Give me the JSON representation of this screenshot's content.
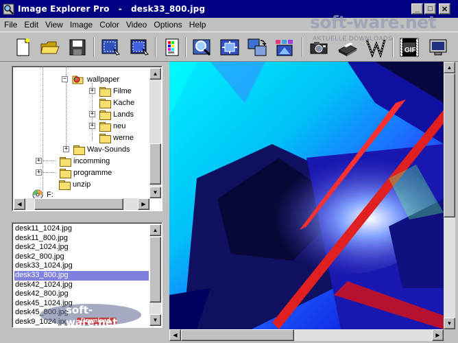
{
  "window": {
    "title": "Image Explorer Pro   -   desk33_800.jpg",
    "buttons": {
      "minimize": "_",
      "maximize": "□",
      "close": "✕"
    }
  },
  "menu": [
    "File",
    "Edit",
    "View",
    "Image",
    "Color",
    "Video",
    "Options",
    "Help"
  ],
  "toolbar": {
    "icons": [
      "new-file-icon",
      "open-folder-icon",
      "save-disk-icon",
      "select-rect-icon",
      "select-active-icon",
      "palette-icon",
      "zoom-icon",
      "fit-window-icon",
      "rotate-icon",
      "thumbnails-icon",
      "camera-icon",
      "scanner-icon",
      "filmstrip-icon",
      "gif-icon",
      "monitor-icon"
    ],
    "gif_label": "GIF"
  },
  "watermark": {
    "top_text": "soft-ware.net",
    "top_sub": "AKTUELLE DOWNLOADS",
    "bottom_text": "soft-ware.net",
    "bottom_sub": "Download"
  },
  "tree": {
    "items": [
      {
        "label": "wallpaper",
        "level": 3,
        "expander": "−",
        "icon": "globe-folder"
      },
      {
        "label": "Filme",
        "level": 4,
        "expander": "+"
      },
      {
        "label": "Kache",
        "level": 4,
        "expander": ""
      },
      {
        "label": "Lands",
        "level": 4,
        "expander": "+"
      },
      {
        "label": "neu",
        "level": 4,
        "expander": "+"
      },
      {
        "label": "werne",
        "level": 4,
        "expander": ""
      },
      {
        "label": "Wav-Sounds",
        "level": 3,
        "expander": "+"
      },
      {
        "label": "incomming",
        "level": 2,
        "expander": "+"
      },
      {
        "label": "programme",
        "level": 2,
        "expander": "+"
      },
      {
        "label": "unzip",
        "level": 2,
        "expander": ""
      },
      {
        "label": "F:",
        "level": 1,
        "expander": "",
        "icon": "cd-drive"
      }
    ]
  },
  "files": {
    "items": [
      "desk11_1024.jpg",
      "desk11_800.jpg",
      "desk2_1024.jpg",
      "desk2_800.jpg",
      "desk33_1024.jpg",
      "desk33_800.jpg",
      "desk42_1024.jpg",
      "desk42_800.jpg",
      "desk45_1024.jpg",
      "desk45_800.jpg",
      "desk9_1024.jpg"
    ],
    "selected": "desk33_800.jpg"
  },
  "colors": {
    "titlebar": "#000080",
    "selection": "#8080e0",
    "face": "#c0c0c0",
    "image_cyan": "#00e8f8",
    "image_blue": "#0000e0"
  }
}
